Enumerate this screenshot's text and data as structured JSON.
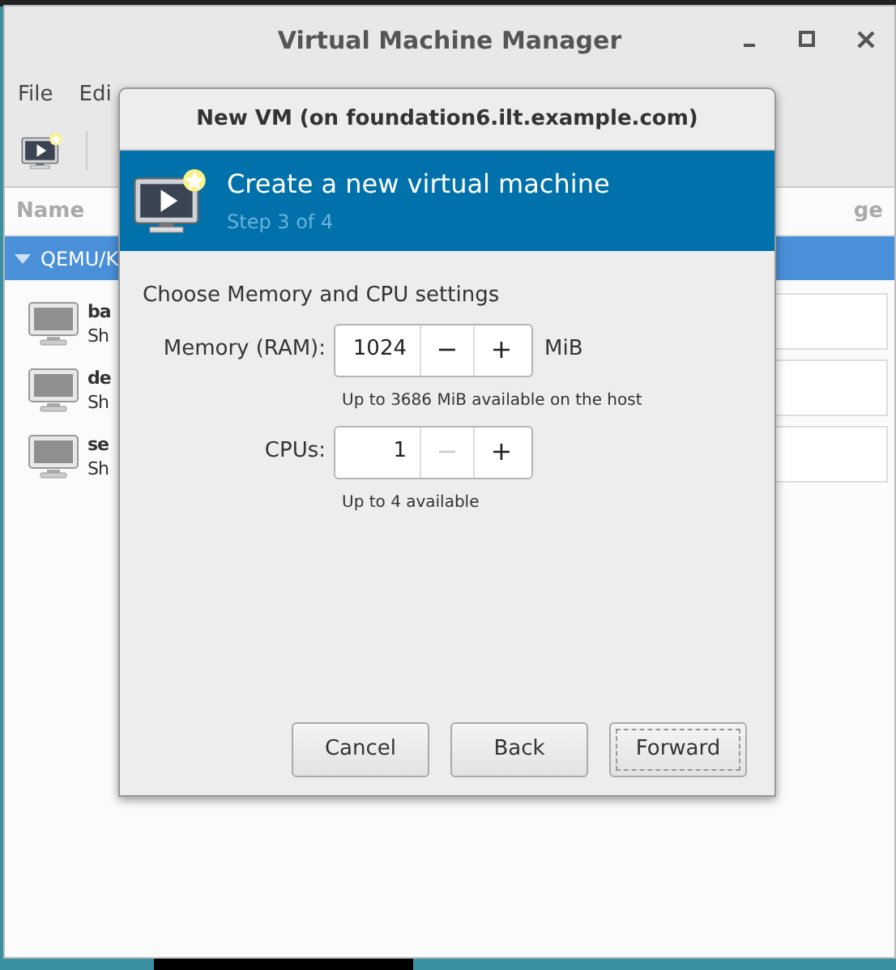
{
  "main_window": {
    "title": "Virtual Machine Manager",
    "menu": [
      "File",
      "Edi"
    ],
    "columns": [
      "Name",
      "ge"
    ],
    "group": {
      "label": "QEMU/K",
      "expanded": true
    },
    "vms": [
      {
        "name": "ba",
        "status": "Sh"
      },
      {
        "name": "de",
        "status": "Sh"
      },
      {
        "name": "se",
        "status": "Sh"
      }
    ]
  },
  "dialog": {
    "title": "New VM (on foundation6.ilt.example.com)",
    "header": {
      "title": "Create a new virtual machine",
      "subtitle": "Step 3 of 4"
    },
    "section": "Choose Memory and CPU settings",
    "fields": [
      {
        "label": "Memory (RAM):",
        "value": "1024",
        "minus": "−",
        "plus": "+",
        "decrement_disabled": false,
        "unit": "MiB",
        "hint": "Up to 3686 MiB available on the host"
      },
      {
        "label": "CPUs:",
        "value": "1",
        "minus": "−",
        "plus": "+",
        "decrement_disabled": true,
        "hint": "Up to 4 available"
      }
    ],
    "buttons": [
      {
        "label": "Cancel",
        "focused": false
      },
      {
        "label": "Back",
        "focused": false
      },
      {
        "label": "Forward",
        "focused": true
      }
    ]
  }
}
